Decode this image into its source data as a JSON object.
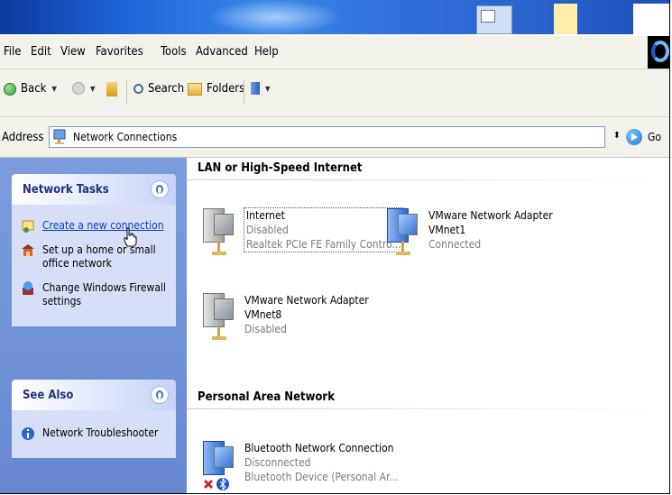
{
  "menu": [
    "File",
    "Edit",
    "View",
    "Favorites",
    "Tools",
    "Advanced",
    "Help"
  ],
  "toolbar": {
    "back": "Back",
    "search": "Search",
    "folders": "Folders"
  },
  "address": {
    "label": "Address",
    "value": "Network Connections",
    "go": "Go"
  },
  "left": {
    "network_tasks": {
      "title": "Network Tasks",
      "items": [
        "Create a new connection",
        "Set up a home or small office network",
        "Change Windows Firewall settings"
      ]
    },
    "see_also": {
      "title": "See Also",
      "items": [
        "Network Troubleshooter"
      ]
    }
  },
  "groups": [
    {
      "title": "LAN or High-Speed Internet"
    },
    {
      "title": "Personal Area Network"
    }
  ],
  "connections": [
    {
      "name": "Internet",
      "status": "Disabled",
      "device": "Realtek PCIe FE Family Contro..."
    },
    {
      "name": "VMware Network Adapter",
      "sub": "VMnet1",
      "status": "Connected"
    },
    {
      "name": "VMware Network Adapter",
      "sub": "VMnet8",
      "status": "Disabled"
    },
    {
      "name": "Bluetooth Network Connection",
      "status": "Disconnected",
      "device": "Bluetooth Device (Personal Ar..."
    }
  ]
}
